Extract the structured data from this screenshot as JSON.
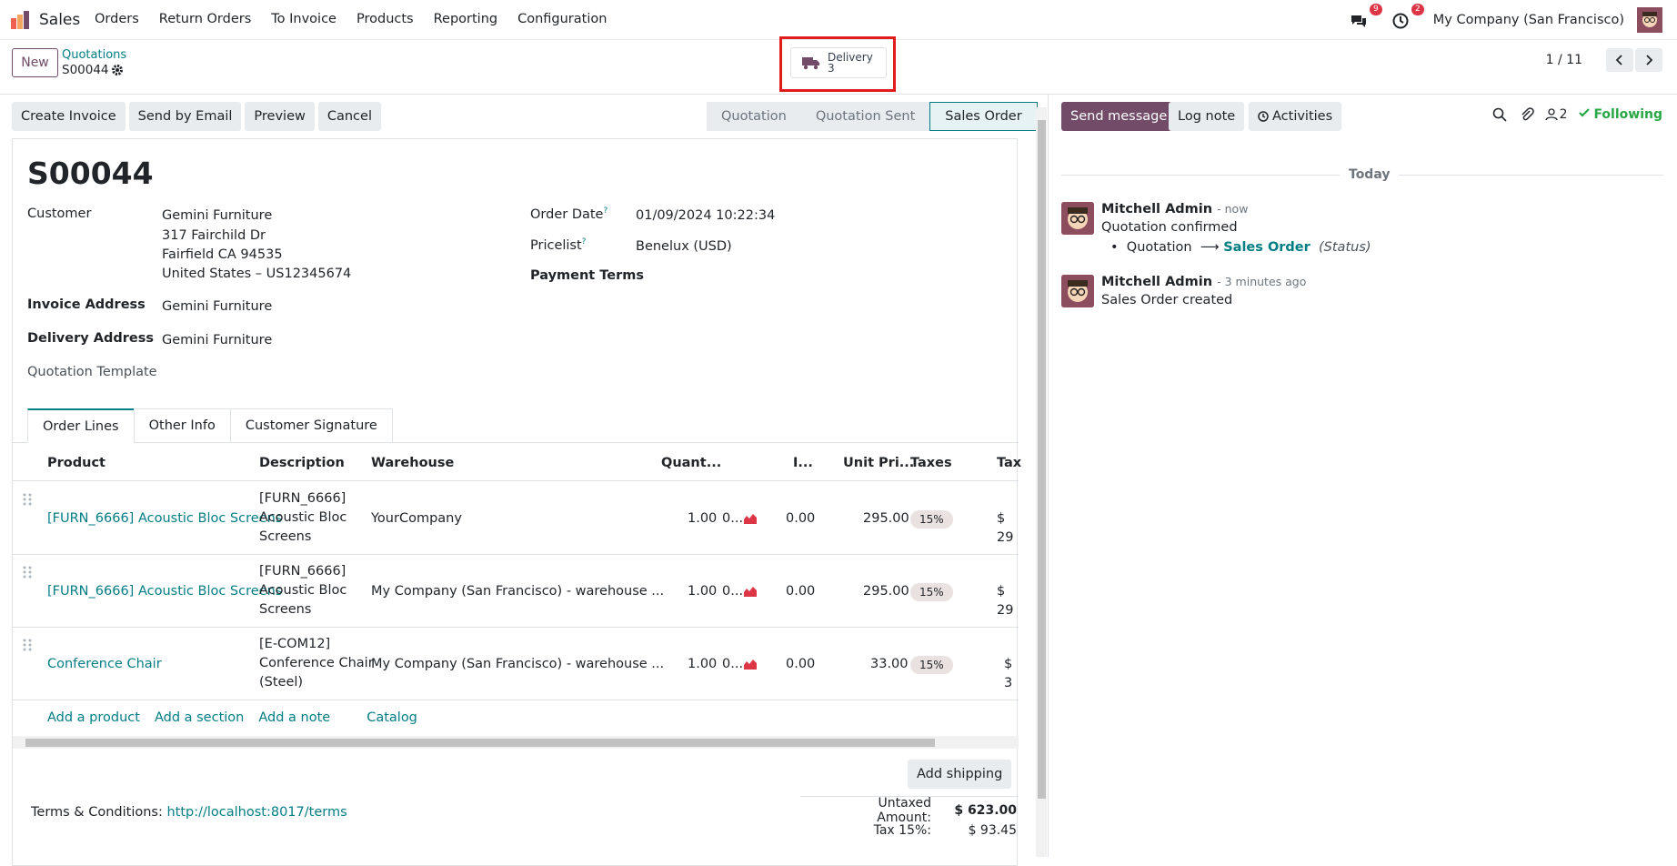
{
  "topbar": {
    "app_name": "Sales",
    "menu": [
      "Orders",
      "Return Orders",
      "To Invoice",
      "Products",
      "Reporting",
      "Configuration"
    ],
    "messages_count": "9",
    "activities_count": "2",
    "company": "My Company (San Francisco)"
  },
  "control": {
    "new_label": "New",
    "breadcrumb_parent": "Quotations",
    "breadcrumb_current": "S00044",
    "smart_button": {
      "label": "Delivery",
      "count": "3"
    },
    "pager": "1 / 11"
  },
  "actions": [
    "Create Invoice",
    "Send by Email",
    "Preview",
    "Cancel"
  ],
  "statusbar": [
    "Quotation",
    "Quotation Sent",
    "Sales Order"
  ],
  "form": {
    "title": "S00044",
    "customer_label": "Customer",
    "customer_name": "Gemini Furniture",
    "customer_addr1": "317 Fairchild Dr",
    "customer_addr2": "Fairfield CA 94535",
    "customer_addr3": "United States – US12345674",
    "invoice_address_label": "Invoice Address",
    "invoice_address": "Gemini Furniture",
    "delivery_address_label": "Delivery Address",
    "delivery_address": "Gemini Furniture",
    "quotation_template_label": "Quotation Template",
    "order_date_label": "Order Date",
    "order_date": "01/09/2024 10:22:34",
    "pricelist_label": "Pricelist",
    "pricelist": "Benelux (USD)",
    "payment_terms_label": "Payment Terms",
    "help_mark": "?"
  },
  "tabs": [
    "Order Lines",
    "Other Info",
    "Customer Signature"
  ],
  "table": {
    "headers": [
      "Product",
      "Description",
      "Warehouse",
      "Quant...",
      "I...",
      "Unit Pri...",
      "Taxes",
      "Tax"
    ],
    "rows": [
      {
        "product": "[FURN_6666] Acoustic Bloc Screens",
        "desc1": "[FURN_6666]",
        "desc2": "Acoustic Bloc",
        "desc3": "Screens",
        "warehouse": "YourCompany",
        "qty": "1.00",
        "delivered": "0...",
        "invoiced": "0.00",
        "price": "295.00",
        "tax": "15%",
        "subtotal": "$ 29"
      },
      {
        "product": "[FURN_6666] Acoustic Bloc Screens",
        "desc1": "[FURN_6666]",
        "desc2": "Acoustic Bloc",
        "desc3": "Screens",
        "warehouse": "My Company (San Francisco) - warehouse ...",
        "qty": "1.00",
        "delivered": "0...",
        "invoiced": "0.00",
        "price": "295.00",
        "tax": "15%",
        "subtotal": "$ 29"
      },
      {
        "product": "Conference Chair",
        "desc1": "[E-COM12]",
        "desc2": "Conference Chair",
        "desc3": "(Steel)",
        "warehouse": "My Company (San Francisco) - warehouse ...",
        "qty": "1.00",
        "delivered": "0...",
        "invoiced": "0.00",
        "price": "33.00",
        "tax": "15%",
        "subtotal": "$ 3"
      }
    ],
    "add_links": [
      "Add a product",
      "Add a section",
      "Add a note",
      "Catalog"
    ]
  },
  "footer": {
    "add_shipping": "Add shipping",
    "terms_label": "Terms & Conditions:",
    "terms_link": "http://localhost:8017/terms",
    "untaxed_label": "Untaxed Amount:",
    "untaxed_value": "$ 623.00",
    "tax_label": "Tax 15%:",
    "tax_value": "$ 93.45"
  },
  "chatter": {
    "send_message": "Send message",
    "log_note": "Log note",
    "activities": "Activities",
    "followers_count": "2",
    "following": "Following",
    "today": "Today",
    "messages": [
      {
        "author": "Mitchell Admin",
        "when": "- now",
        "body": "Quotation confirmed",
        "track_from": "Quotation",
        "track_to": "Sales Order",
        "track_field": "(Status)"
      },
      {
        "author": "Mitchell Admin",
        "when": "- 3 minutes ago",
        "body": "Sales Order created"
      }
    ]
  },
  "colors": {
    "primary": "#714b67",
    "link": "#017e84",
    "highlight": "#e11c1c",
    "badge": "#dc3545"
  }
}
